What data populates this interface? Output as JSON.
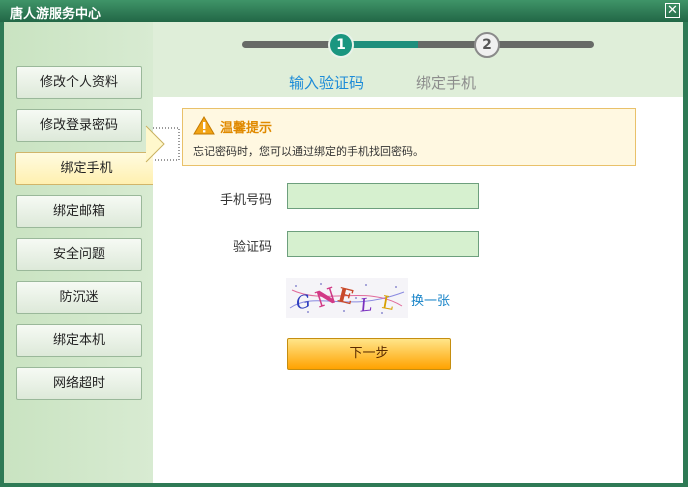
{
  "window": {
    "title": "唐人游服务中心",
    "close_symbol": "✕"
  },
  "sidebar": {
    "active_index": 2,
    "items": [
      {
        "label": "修改个人资料"
      },
      {
        "label": "修改登录密码"
      },
      {
        "label": "绑定手机"
      },
      {
        "label": "绑定邮箱"
      },
      {
        "label": "安全问题"
      },
      {
        "label": "防沉迷"
      },
      {
        "label": "绑定本机"
      },
      {
        "label": "网络超时"
      }
    ]
  },
  "stepper": {
    "current_step": 1,
    "steps": [
      {
        "number": "1",
        "label": "输入验证码"
      },
      {
        "number": "2",
        "label": "绑定手机"
      }
    ]
  },
  "notice": {
    "icon": "warning-icon",
    "title": "温馨提示",
    "text": "忘记密码时，您可以通过绑定的手机找回密码。"
  },
  "form": {
    "phone_label": "手机号码",
    "phone_value": "",
    "code_label": "验证码",
    "code_value": "",
    "captcha": {
      "icon": "captcha-image",
      "text": "GNELL"
    },
    "refresh_label": "换一张",
    "submit_label": "下一步"
  },
  "colors": {
    "frame": "#2e7a55",
    "step_active": "#1a9680",
    "step_label_active": "#1c8bd8",
    "notice_title": "#e08a00",
    "link": "#1a85c9",
    "button": "#ffa200"
  }
}
